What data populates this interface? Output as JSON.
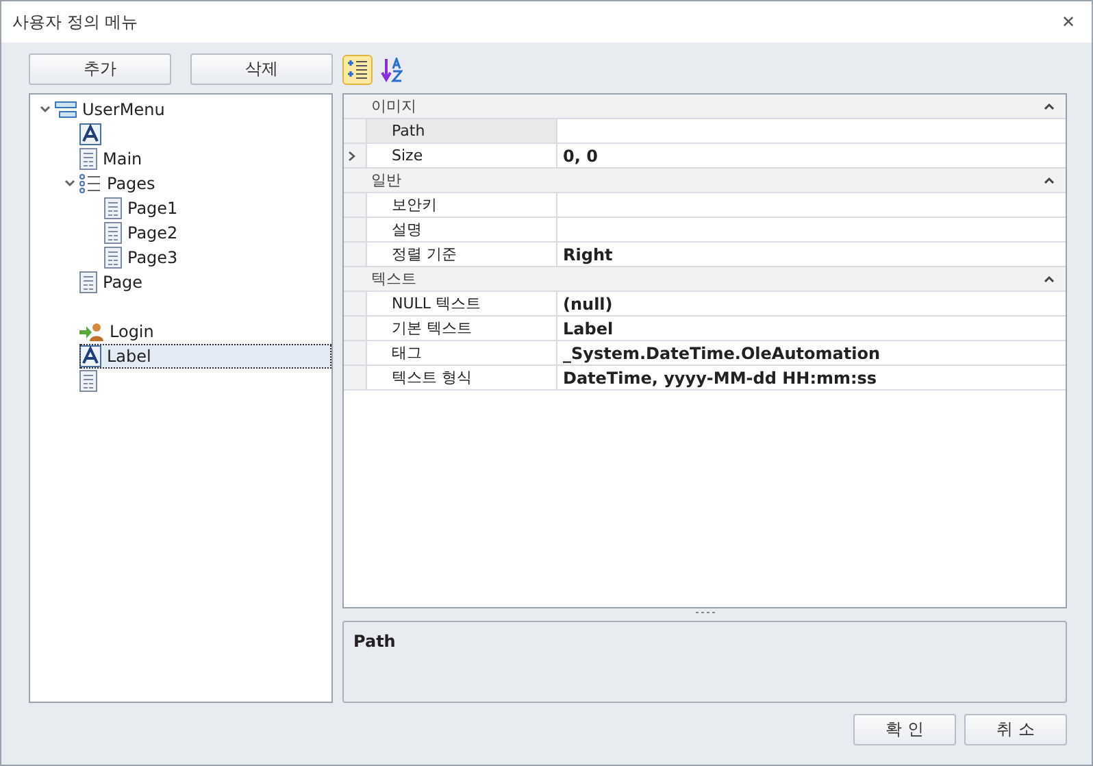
{
  "window": {
    "title": "사용자 정의 메뉴",
    "close": "✕"
  },
  "left_buttons": [
    "추가",
    "삭제"
  ],
  "tree": [
    {
      "kind": "menu",
      "label": "UserMenu",
      "expanded": true,
      "selected": false,
      "children": [
        {
          "kind": "label",
          "selected": false
        },
        {
          "kind": "page",
          "label": "Main",
          "selected": false
        },
        {
          "kind": "pages",
          "label": "Pages",
          "expanded": true,
          "selected": false,
          "children": [
            {
              "kind": "page",
              "label": "Page1",
              "selected": false
            },
            {
              "kind": "page",
              "label": "Page2",
              "selected": false
            },
            {
              "kind": "page",
              "label": "Page3",
              "selected": false
            }
          ]
        },
        {
          "kind": "page",
          "label": "Page",
          "selected": false
        },
        {
          "kind": "blank"
        },
        {
          "kind": "login",
          "label": "Login",
          "selected": false
        },
        {
          "kind": "label",
          "label": "Label",
          "selected": true
        },
        {
          "kind": "page",
          "selected": false
        }
      ]
    }
  ],
  "toolbar": [
    {
      "kind": "categorized",
      "selected": true
    },
    {
      "kind": "alphabetical",
      "selected": false
    }
  ],
  "categories": [
    {
      "name": "이미지",
      "expanded": true,
      "rows": [
        {
          "name": "Path",
          "selected": true
        },
        {
          "name": "Size",
          "value": "0, 0",
          "expandable": true,
          "selected": false
        }
      ]
    },
    {
      "name": "일반",
      "expanded": true,
      "rows": [
        {
          "name": "보안키",
          "selected": false
        },
        {
          "name": "설명",
          "selected": false
        },
        {
          "name": "정렬 기준",
          "value": "Right",
          "selected": false
        }
      ]
    },
    {
      "name": "텍스트",
      "expanded": true,
      "rows": [
        {
          "name": "NULL 텍스트",
          "value": "(null)",
          "selected": false
        },
        {
          "name": "기본 텍스트",
          "value": "Label",
          "selected": false
        },
        {
          "name": "태그",
          "value": "_System.DateTime.OleAutomation",
          "selected": false
        },
        {
          "name": "텍스트 형식",
          "value": "DateTime, yyyy-MM-dd HH:mm:ss",
          "selected": false
        }
      ]
    }
  ],
  "description": {
    "title": "Path"
  },
  "dialog_buttons": [
    "확 인",
    "취 소"
  ]
}
